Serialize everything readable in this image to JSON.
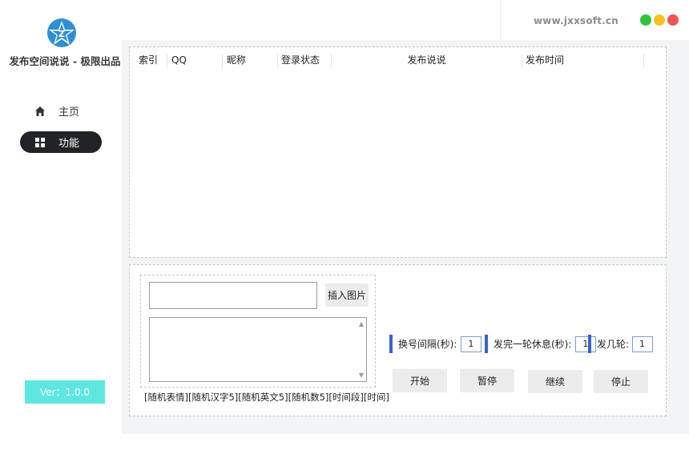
{
  "app": {
    "title": "发布空间说说 - 极限出品",
    "site_url": "www.jxxsoft.cn",
    "version": "Ver：1.0.0",
    "logo_icon": "qzone-star-logo-icon"
  },
  "colors": {
    "accent_cyan": "#5de7e0",
    "nav_active": "#222326",
    "param_bar": "#3a63c9",
    "dot_green": "#30c23f",
    "dot_yellow": "#f6c022",
    "dot_red": "#f25555"
  },
  "sidebar": {
    "items": [
      {
        "label": "主页",
        "icon": "home-icon"
      },
      {
        "label": "功能",
        "icon": "grid-icon"
      }
    ]
  },
  "table": {
    "columns": [
      "索引",
      "QQ",
      "昵称",
      "登录状态",
      "发布说说",
      "发布时间"
    ],
    "rows": []
  },
  "compose": {
    "input_value": "",
    "insert_image_label": "插入图片",
    "textarea_value": "",
    "tokens": [
      "[随机表情]",
      "[随机汉字5]",
      "[随机英文5]",
      "[随机数5]",
      "[时间段]",
      "[时间]"
    ]
  },
  "params": {
    "interval_label": "换号间隔(秒):",
    "interval_value": "1",
    "rest_label": "发完一轮休息(秒):",
    "rest_value": "1",
    "rounds_label": "发几轮:",
    "rounds_value": "1"
  },
  "actions": {
    "start": "开始",
    "pause": "暂停",
    "continue": "继续",
    "stop": "停止"
  }
}
